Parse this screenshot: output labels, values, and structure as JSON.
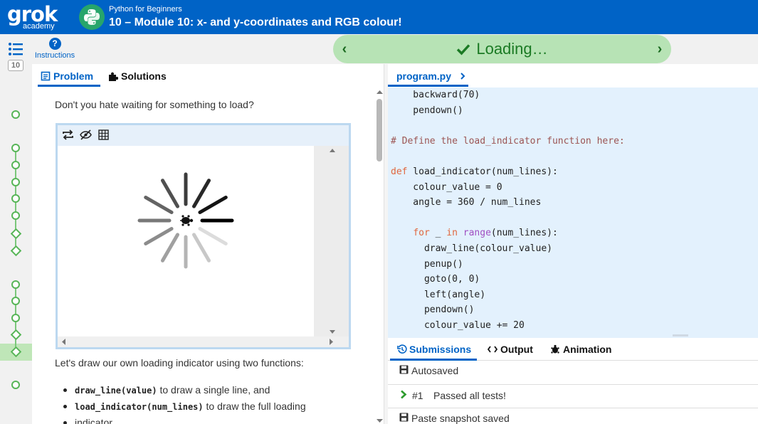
{
  "header": {
    "logo_text": "grok",
    "logo_sub": "academy",
    "course_name": "Python for Beginners",
    "lesson_title": "10 – Module 10: x- and y-coordinates and RGB colour!"
  },
  "toolbar": {
    "instructions_label": "Instructions",
    "instructions_icon": "?",
    "status_text": "Loading…",
    "prev_arrow": "‹",
    "next_arrow": "›"
  },
  "rail": {
    "counter": "10"
  },
  "problem": {
    "tabs": [
      "Problem",
      "Solutions"
    ],
    "intro": "Don't you hate waiting for something to load?",
    "para2": "Let's draw our own loading indicator using two functions:",
    "bullets": [
      {
        "code": "draw_line(value)",
        "text": " to draw a single line, and"
      },
      {
        "code": "load_indicator(num_lines)",
        "text": " to draw the full loading"
      },
      {
        "code": "",
        "text": "indicator."
      }
    ]
  },
  "editor": {
    "file_tab": "program.py",
    "lines": [
      "    backward(70)",
      "    pendown()",
      "",
      "# Define the load_indicator function here:",
      "",
      "def load_indicator(num_lines):",
      "    colour_value = 0",
      "    angle = 360 / num_lines",
      "",
      "    for _ in range(num_lines):",
      "      draw_line(colour_value)",
      "      penup()",
      "      goto(0, 0)",
      "      left(angle)",
      "      pendown()",
      "      colour_value += 20"
    ]
  },
  "output": {
    "tabs": [
      "Submissions",
      "Output",
      "Animation"
    ],
    "rows": [
      {
        "icon": "floppy-icon",
        "prefix": "",
        "text": "Autosaved"
      },
      {
        "icon": "chevron-right-icon",
        "prefix": "#1",
        "text": "Passed all tests!"
      },
      {
        "icon": "floppy-icon",
        "prefix": "",
        "text": "Paste snapshot saved"
      }
    ]
  },
  "colors": {
    "header_bg": "#0063c6",
    "status_pill": "#b7e3b5",
    "code_bg": "#e3f1fd",
    "keyword": "#e0673e",
    "builtin": "#a04fc2",
    "comment": "#9c5553"
  },
  "icons": [
    "python-icon",
    "menu-list-icon",
    "help-icon",
    "check-icon",
    "problem-doc-icon",
    "puzzle-icon",
    "swap-icon",
    "eye-off-icon",
    "grid-icon",
    "history-icon",
    "code-icon",
    "turtle-icon",
    "floppy-icon"
  ]
}
